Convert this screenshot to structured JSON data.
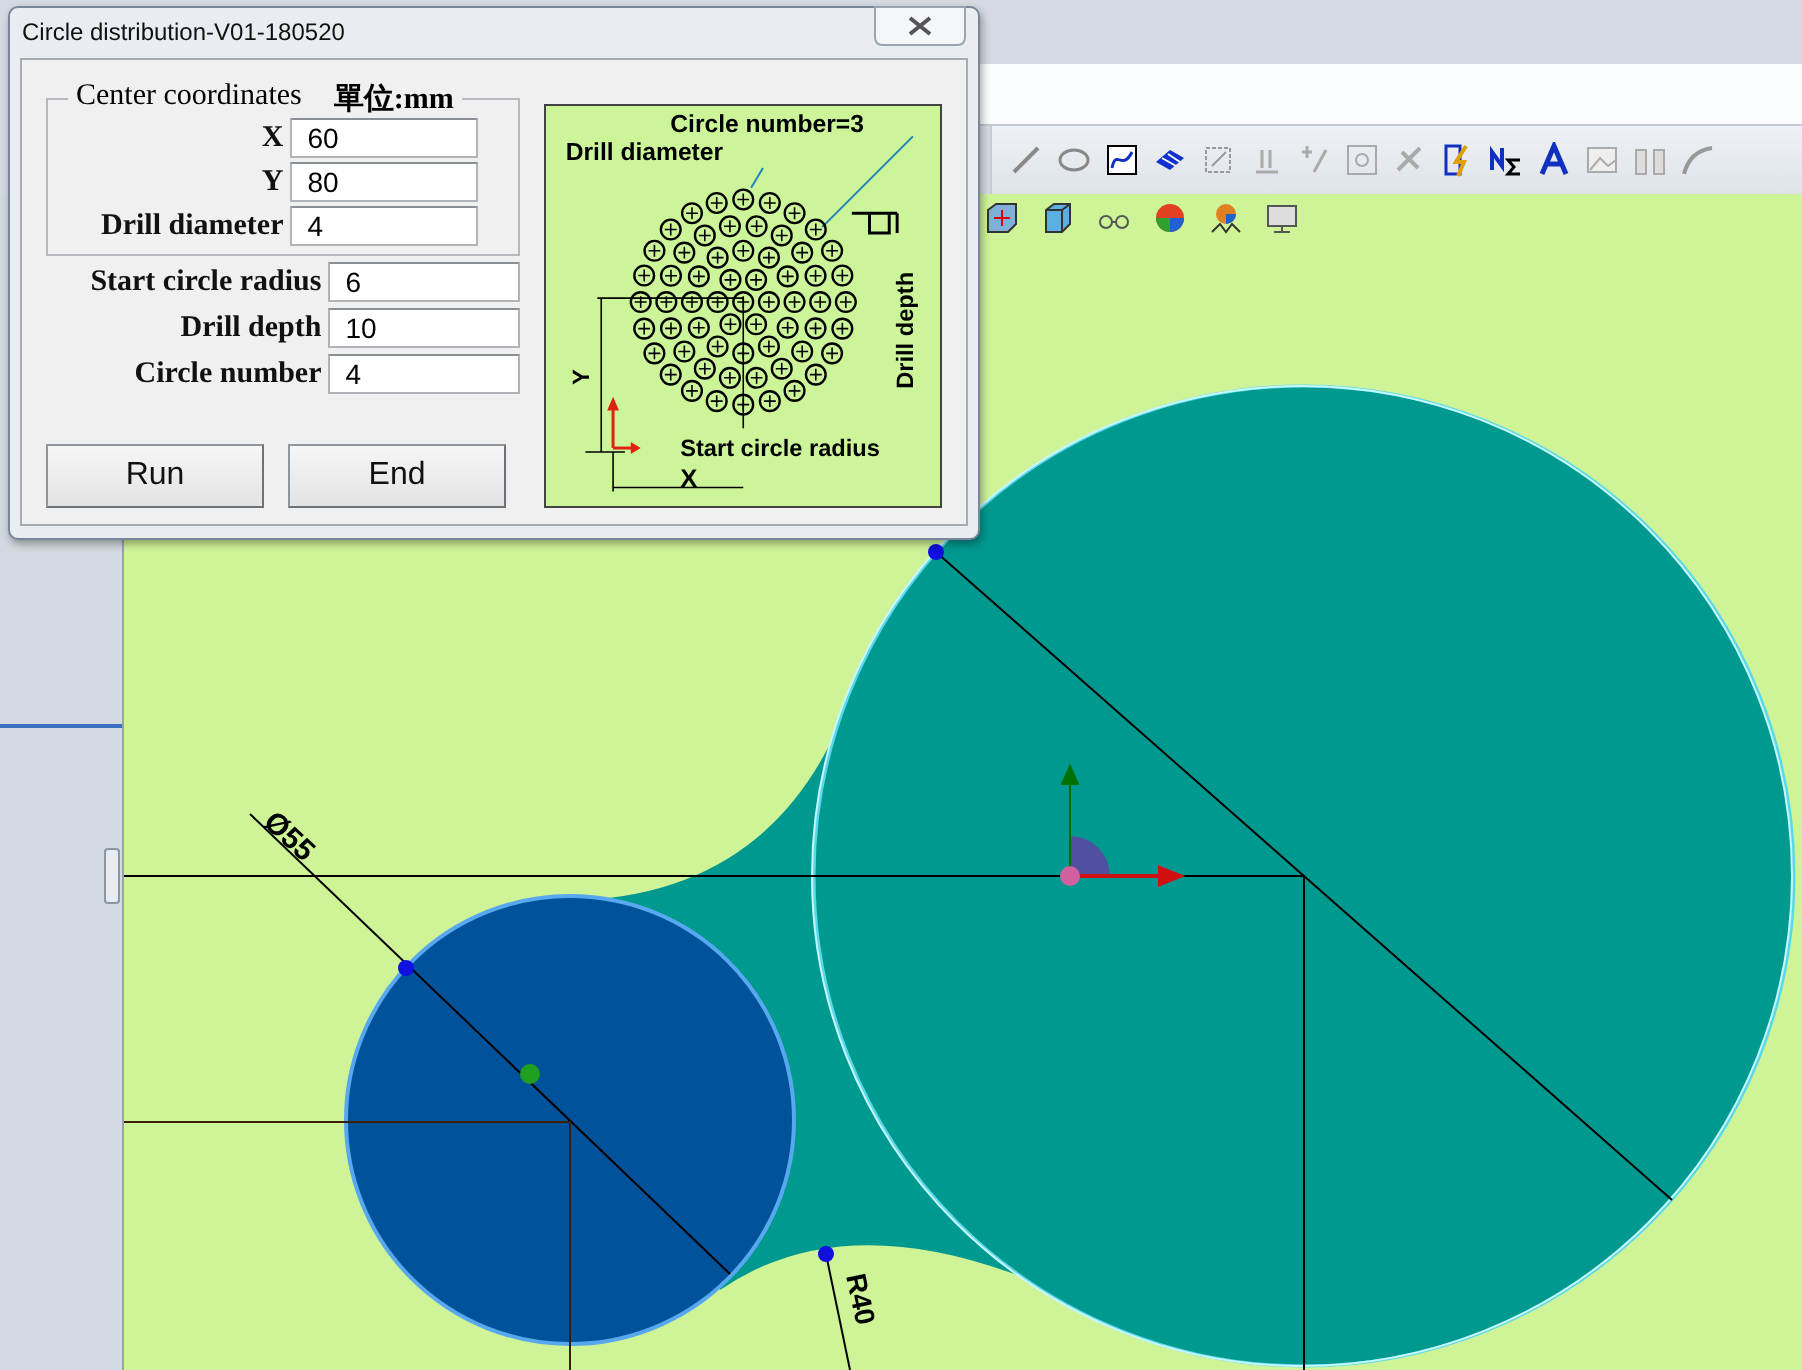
{
  "dialog": {
    "title": "Circle distribution-V01-180520",
    "center_group": {
      "legend": "Center coordinates",
      "unit": "單位:mm",
      "fields": [
        {
          "label": "X",
          "value": "60"
        },
        {
          "label": "Y",
          "value": "80"
        },
        {
          "label": "Drill diameter",
          "value": "4"
        }
      ]
    },
    "fields": [
      {
        "label": "Start circle radius",
        "value": "6"
      },
      {
        "label": "Drill depth",
        "value": "10"
      },
      {
        "label": "Circle number",
        "value": "4"
      }
    ],
    "buttons": [
      "Run",
      "End"
    ],
    "diagram": {
      "circle_number": "Circle number=3",
      "drill_diameter": "Drill diameter",
      "drill_depth": "Drill depth",
      "start_radius": "Start circle radius",
      "y_label": "Y",
      "x_label": "X"
    }
  },
  "sketch": {
    "diameter_dimension": "Ø55",
    "radius_dimension": "R40"
  }
}
